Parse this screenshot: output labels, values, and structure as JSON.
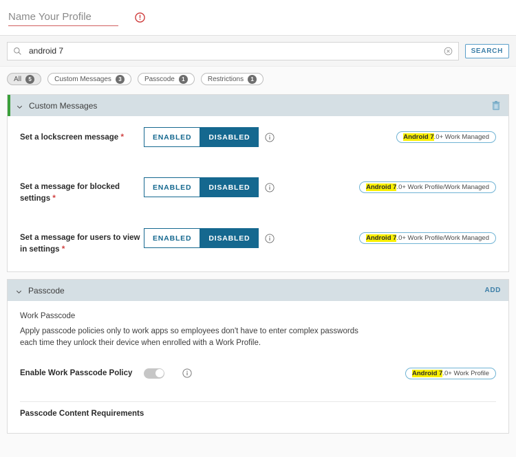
{
  "profile": {
    "name_value": "",
    "name_placeholder": "Name Your Profile",
    "error_icon": "error-circle-icon"
  },
  "search": {
    "value": "android 7",
    "placeholder": "Search",
    "search_icon": "search-icon",
    "clear_icon": "clear-circle-icon",
    "button_label": "SEARCH"
  },
  "filters": [
    {
      "label": "All",
      "count": "5",
      "selected": true
    },
    {
      "label": "Custom Messages",
      "count": "3",
      "selected": false
    },
    {
      "label": "Passcode",
      "count": "1",
      "selected": false
    },
    {
      "label": "Restrictions",
      "count": "1",
      "selected": false
    }
  ],
  "sections": [
    {
      "title": "Custom Messages",
      "action_label": "",
      "action_icon": "trash-icon"
    },
    {
      "title": "Passcode",
      "action_label": "ADD",
      "action_icon": ""
    }
  ],
  "custom_messages": {
    "rows": [
      {
        "label": "Set a lockscreen message",
        "required": "*",
        "enabled_label": "ENABLED",
        "disabled_label": "DISABLED",
        "selected": "DISABLED",
        "badge_highlight": "Android 7",
        "badge_rest": ".0+ Work Managed"
      },
      {
        "label": "Set a message for blocked settings",
        "required": "*",
        "enabled_label": "ENABLED",
        "disabled_label": "DISABLED",
        "selected": "DISABLED",
        "badge_highlight": "Android 7",
        "badge_rest": ".0+ Work Profile/Work Managed"
      },
      {
        "label": "Set a message for users to view in settings",
        "required": "*",
        "enabled_label": "ENABLED",
        "disabled_label": "DISABLED",
        "selected": "DISABLED",
        "badge_highlight": "Android 7",
        "badge_rest": ".0+ Work Profile/Work Managed"
      }
    ]
  },
  "passcode": {
    "work_passcode_title": "Work Passcode",
    "work_passcode_desc": "Apply passcode policies only to work apps so employees don't have to enter complex passwords each time they unlock their device when enrolled with a Work Profile.",
    "enable_label": "Enable Work Passcode Policy",
    "toggle_state": "off",
    "badge_highlight": "Android 7",
    "badge_rest": ".0+ Work Profile",
    "content_requirements_title": "Passcode Content Requirements"
  },
  "colors": {
    "accent_green": "#3a9f3a",
    "header_bg": "#d5dfe4",
    "primary_blue": "#15688f",
    "link_blue": "#3d7fa8",
    "error_red": "#d14545",
    "highlight_yellow": "#f9f000"
  }
}
